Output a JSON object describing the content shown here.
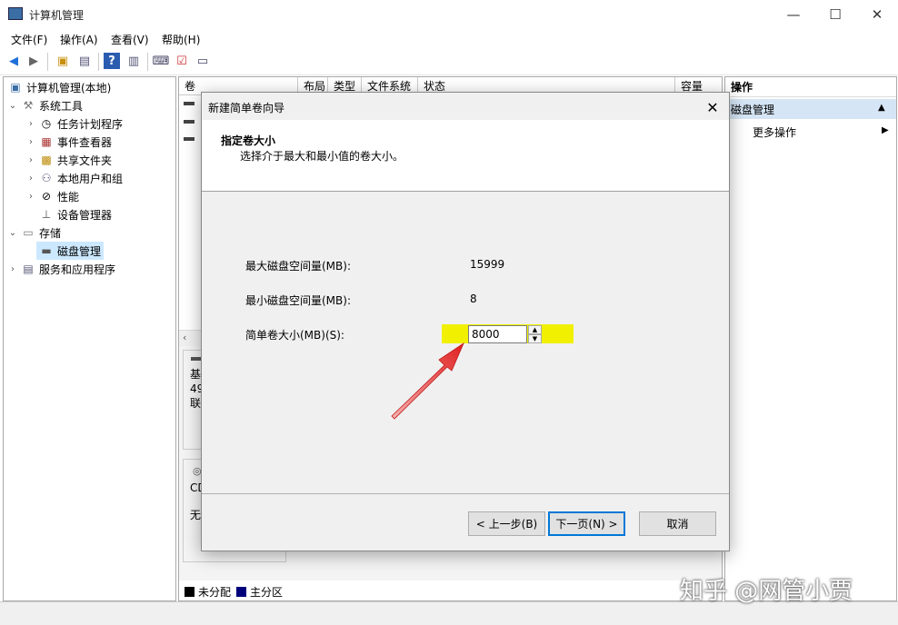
{
  "window": {
    "title": "计算机管理",
    "min": "—",
    "max": "☐",
    "close": "✕"
  },
  "menu": [
    "文件(F)",
    "操作(A)",
    "查看(V)",
    "帮助(H)"
  ],
  "tree": [
    {
      "label": "计算机管理(本地)"
    },
    {
      "label": "系统工具"
    },
    {
      "label": "任务计划程序"
    },
    {
      "label": "事件查看器"
    },
    {
      "label": "共享文件夹"
    },
    {
      "label": "本地用户和组"
    },
    {
      "label": "性能"
    },
    {
      "label": "设备管理器"
    },
    {
      "label": "存储"
    },
    {
      "label": "磁盘管理"
    },
    {
      "label": "服务和应用程序"
    }
  ],
  "columns": [
    "卷",
    "布局",
    "类型",
    "文件系统",
    "状态",
    "容量"
  ],
  "mid_lower": {
    "disk0": [
      "基",
      "49",
      "联"
    ],
    "cd": [
      "CD",
      "无"
    ],
    "legend_unalloc": "未分配",
    "legend_primary": "主分区"
  },
  "actions": {
    "header": "操作",
    "section": "磁盘管理",
    "more": "更多操作"
  },
  "dialog": {
    "title": "新建简单卷向导",
    "heading": "指定卷大小",
    "subheading": "选择介于最大和最小值的卷大小。",
    "max_label": "最大磁盘空间量(MB):",
    "max_value": "15999",
    "min_label": "最小磁盘空间量(MB):",
    "min_value": "8",
    "size_label": "简单卷大小(MB)(S):",
    "size_value": "8000",
    "back": "< 上一步(B)",
    "next": "下一页(N) >",
    "cancel": "取消"
  },
  "watermark": "知乎 @网管小贾",
  "colors": {
    "highlight": "#f0f000",
    "arrow": "#e02020",
    "accent": "#0078d7"
  }
}
